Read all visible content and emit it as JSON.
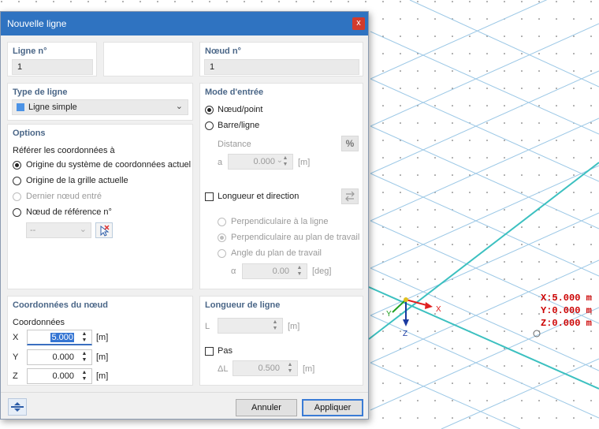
{
  "dialog": {
    "title": "Nouvelle ligne",
    "close_symbol": "x"
  },
  "line_no": {
    "label": "Ligne n°",
    "value": "1"
  },
  "node_no": {
    "label": "Nœud n°",
    "value": "1"
  },
  "line_type": {
    "label": "Type de ligne",
    "value": "Ligne simple",
    "swatch_color": "#4c93e6"
  },
  "options": {
    "title": "Options",
    "ref_label": "Référer les coordonnées à",
    "radios": [
      {
        "label": "Origine du système de coordonnées actuel",
        "checked": true,
        "enabled": true
      },
      {
        "label": "Origine de la grille actuelle",
        "checked": false,
        "enabled": true
      },
      {
        "label": "Dernier nœud entré",
        "checked": false,
        "enabled": false
      },
      {
        "label": "Nœud de référence n°",
        "checked": false,
        "enabled": true
      }
    ],
    "ref_node_value": "--"
  },
  "input_mode": {
    "title": "Mode d'entrée",
    "radio_node": "Nœud/point",
    "radio_bar": "Barre/ligne",
    "distance_label": "Distance",
    "percent_symbol": "%",
    "a_label": "a",
    "a_value": "0.000",
    "a_unit": "[m]",
    "length_dir_label": "Longueur et direction",
    "sub_radios": [
      "Perpendiculaire à la ligne",
      "Perpendiculaire au plan de travail",
      "Angle du plan de travail"
    ],
    "alpha_label": "α",
    "alpha_value": "0.00",
    "alpha_unit": "[deg]"
  },
  "node_coords": {
    "title": "Coordonnées du nœud",
    "subtitle": "Coordonnées",
    "rows": [
      {
        "axis": "X",
        "value": "5.000",
        "unit": "[m]"
      },
      {
        "axis": "Y",
        "value": "0.000",
        "unit": "[m]"
      },
      {
        "axis": "Z",
        "value": "0.000",
        "unit": "[m]"
      }
    ]
  },
  "line_length": {
    "title": "Longueur de ligne",
    "l_label": "L",
    "l_unit": "[m]",
    "step_label": "Pas",
    "delta_label": "ΔL",
    "delta_value": "0.500",
    "delta_unit": "[m]"
  },
  "buttons": {
    "cancel": "Annuler",
    "apply": "Appliquer"
  },
  "viewport": {
    "axis_x": "X",
    "axis_y": "Y",
    "axis_z": "Z",
    "coord_x": "X:5.000 m",
    "coord_y": "Y:0.000 m",
    "coord_z": "Z:0.000 m",
    "line_color": "#3cc0c0",
    "grid_color": "#9cc8e6",
    "readout_color": "#cc0000"
  }
}
